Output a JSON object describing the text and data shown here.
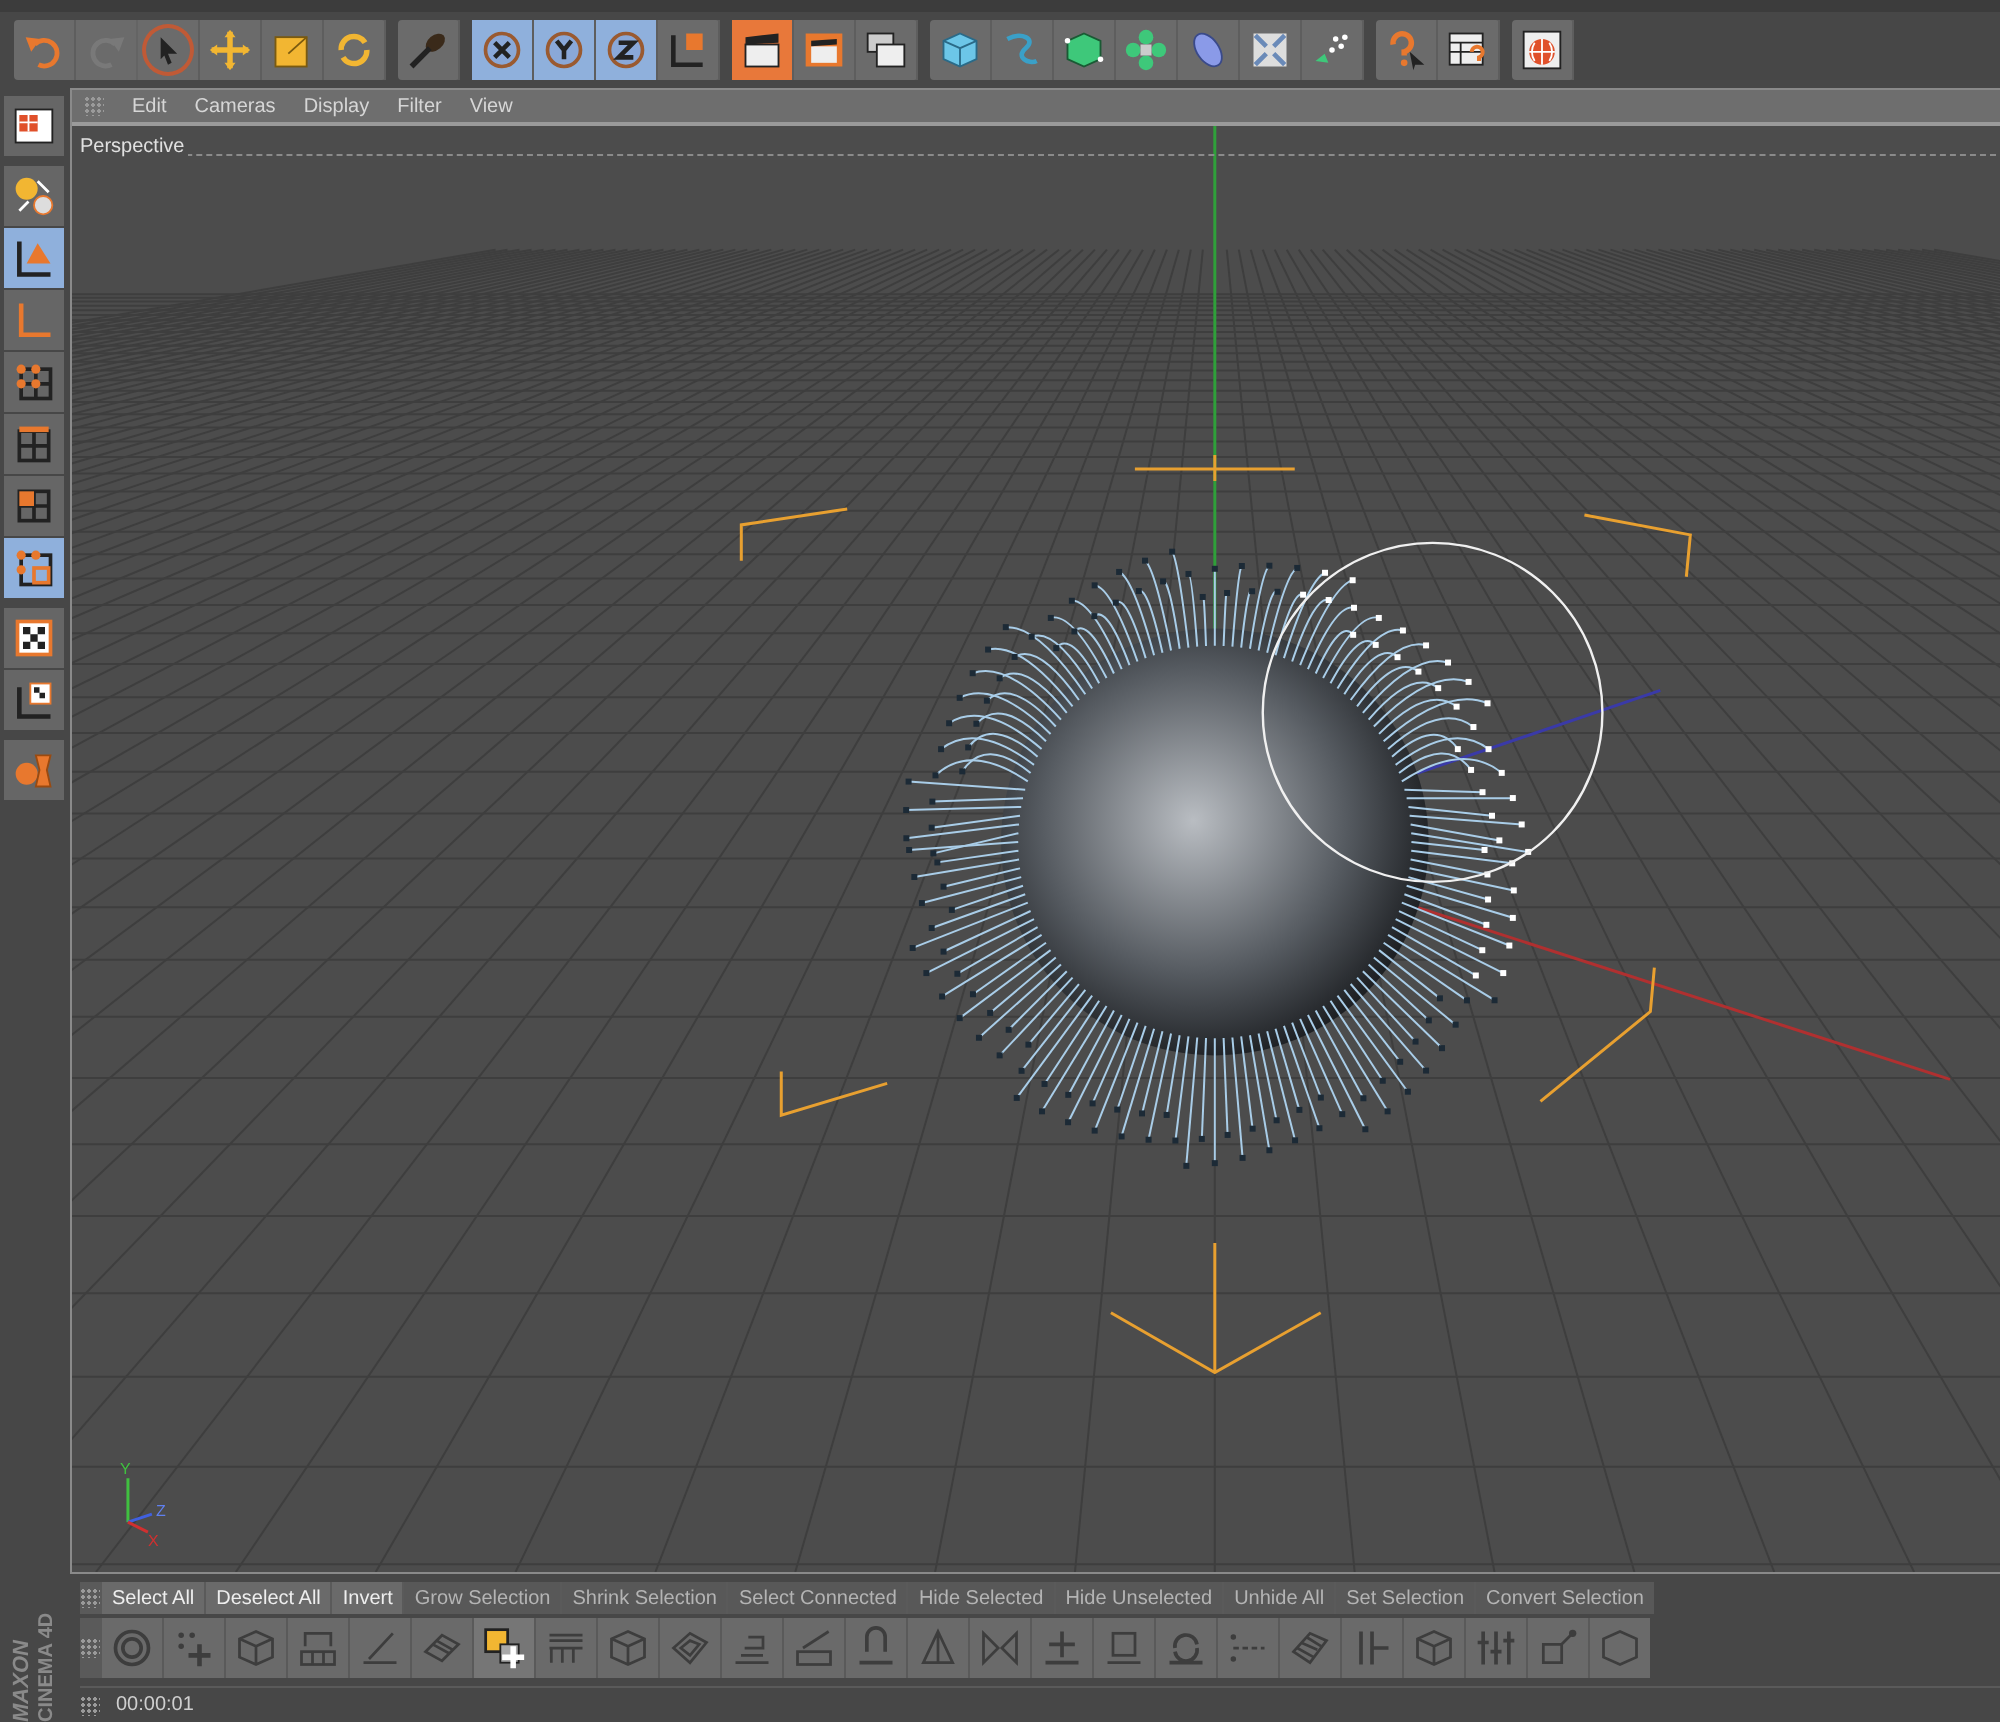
{
  "toolbar_groups": [
    {
      "kind": "tools",
      "buttons": [
        {
          "selected": false,
          "disabled": false
        },
        {
          "selected": false,
          "disabled": true
        },
        {
          "selected": true,
          "disabled": false
        },
        {
          "selected": false,
          "disabled": false
        },
        {
          "selected": false,
          "disabled": false
        },
        {
          "selected": false,
          "disabled": false
        }
      ]
    },
    {
      "kind": "tools",
      "buttons": [
        {
          "selected": false,
          "disabled": false
        }
      ]
    },
    {
      "kind": "axis",
      "buttons": [
        {
          "selected": true,
          "disabled": false
        },
        {
          "selected": true,
          "disabled": false
        },
        {
          "selected": true,
          "disabled": false
        },
        {
          "selected": false,
          "disabled": false
        }
      ]
    },
    {
      "kind": "render",
      "buttons": [
        {
          "selected": true,
          "disabled": false
        },
        {
          "selected": false,
          "disabled": false
        },
        {
          "selected": false,
          "disabled": false
        }
      ]
    },
    {
      "kind": "objects",
      "buttons": [
        {
          "selected": false,
          "disabled": false
        },
        {
          "selected": false,
          "disabled": false
        },
        {
          "selected": false,
          "disabled": false
        },
        {
          "selected": false,
          "disabled": false
        },
        {
          "selected": false,
          "disabled": false
        },
        {
          "selected": false,
          "disabled": false
        },
        {
          "selected": false,
          "disabled": false
        }
      ]
    },
    {
      "kind": "objects",
      "buttons": [
        {
          "selected": false,
          "disabled": false
        },
        {
          "selected": false,
          "disabled": false
        }
      ]
    },
    {
      "kind": "objects",
      "buttons": [
        {
          "selected": false,
          "disabled": false
        }
      ]
    }
  ],
  "mode_tools": [
    {
      "selected": false
    },
    {
      "selected": false
    },
    {
      "selected": true
    },
    {
      "selected": false
    },
    {
      "selected": false
    },
    {
      "selected": false
    },
    {
      "selected": false
    },
    {
      "selected": true
    },
    {
      "selected": false
    },
    {
      "selected": false
    },
    {
      "selected": false
    }
  ],
  "viewport": {
    "menu": [
      "Edit",
      "Cameras",
      "Display",
      "Filter",
      "View"
    ],
    "label": "Perspective",
    "axis_labels": [
      "Y",
      "Z",
      "X"
    ]
  },
  "logo": [
    "MAXON",
    "CINEMA 4D"
  ],
  "commands": [
    {
      "label": "Select All",
      "disabled": false
    },
    {
      "label": "Deselect All",
      "disabled": false
    },
    {
      "label": "Invert",
      "disabled": false
    },
    {
      "label": "Grow Selection",
      "disabled": true
    },
    {
      "label": "Shrink Selection",
      "disabled": true
    },
    {
      "label": "Select Connected",
      "disabled": true
    },
    {
      "label": "Hide Selected",
      "disabled": true
    },
    {
      "label": "Hide Unselected",
      "disabled": true
    },
    {
      "label": "Unhide All",
      "disabled": true
    },
    {
      "label": "Set Selection",
      "disabled": true
    },
    {
      "label": "Convert Selection",
      "disabled": true
    }
  ],
  "modeling_tools": [
    {
      "selected": false
    },
    {
      "selected": false
    },
    {
      "selected": false
    },
    {
      "selected": false
    },
    {
      "selected": false
    },
    {
      "selected": false
    },
    {
      "selected": true
    },
    {
      "selected": false
    },
    {
      "selected": false
    },
    {
      "selected": false
    },
    {
      "selected": false
    },
    {
      "selected": false
    },
    {
      "selected": false
    },
    {
      "selected": false
    },
    {
      "selected": false
    },
    {
      "selected": false
    },
    {
      "selected": false
    },
    {
      "selected": false
    },
    {
      "selected": false
    },
    {
      "selected": false
    },
    {
      "selected": false
    },
    {
      "selected": false
    },
    {
      "selected": false
    },
    {
      "selected": false
    },
    {
      "selected": false
    }
  ],
  "status": {
    "time": "00:00:01"
  }
}
